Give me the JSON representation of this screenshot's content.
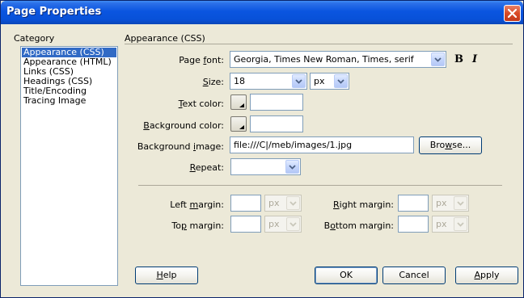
{
  "window": {
    "title": "Page Properties"
  },
  "category": {
    "heading": "Category",
    "items": [
      {
        "label": "Appearance (CSS)",
        "selected": true
      },
      {
        "label": "Appearance (HTML)",
        "selected": false
      },
      {
        "label": "Links (CSS)",
        "selected": false
      },
      {
        "label": "Headings (CSS)",
        "selected": false
      },
      {
        "label": "Title/Encoding",
        "selected": false
      },
      {
        "label": "Tracing Image",
        "selected": false
      }
    ]
  },
  "section": {
    "heading": "Appearance (CSS)"
  },
  "page_font": {
    "label_pre": "Page ",
    "label_key": "f",
    "label_post": "ont:",
    "value": "Georgia, Times New Roman, Times, serif",
    "bold_icon": "B",
    "italic_icon": "I"
  },
  "size": {
    "label_pre": "",
    "label_key": "S",
    "label_post": "ize:",
    "value": "18",
    "unit": "px"
  },
  "text_color": {
    "label_pre": "",
    "label_key": "T",
    "label_post": "ext color:",
    "value": ""
  },
  "background_color": {
    "label_pre": "",
    "label_key": "B",
    "label_post": "ackground color:",
    "value": ""
  },
  "background_image": {
    "label_pre": "Background ",
    "label_key": "i",
    "label_post": "mage:",
    "value": "file:///C|/meb/images/1.jpg",
    "browse_pre": "Bro",
    "browse_key": "w",
    "browse_post": "se..."
  },
  "repeat": {
    "label_pre": "",
    "label_key": "R",
    "label_post": "epeat:",
    "value": ""
  },
  "margins": {
    "left": {
      "label_pre": "Left ",
      "label_key": "m",
      "label_post": "argin:",
      "value": "",
      "unit": "px"
    },
    "right": {
      "label_pre": "",
      "label_key": "R",
      "label_post": "ight margin:",
      "value": "",
      "unit": "px"
    },
    "top": {
      "label_pre": "To",
      "label_key": "p",
      "label_post": " margin:",
      "value": "",
      "unit": "px"
    },
    "bottom": {
      "label_pre": "B",
      "label_key": "o",
      "label_post": "ttom margin:",
      "value": "",
      "unit": "px"
    }
  },
  "buttons": {
    "help_pre": "",
    "help_key": "H",
    "help_post": "elp",
    "ok": "OK",
    "cancel": "Cancel",
    "apply_pre": "",
    "apply_key": "A",
    "apply_post": "pply"
  }
}
